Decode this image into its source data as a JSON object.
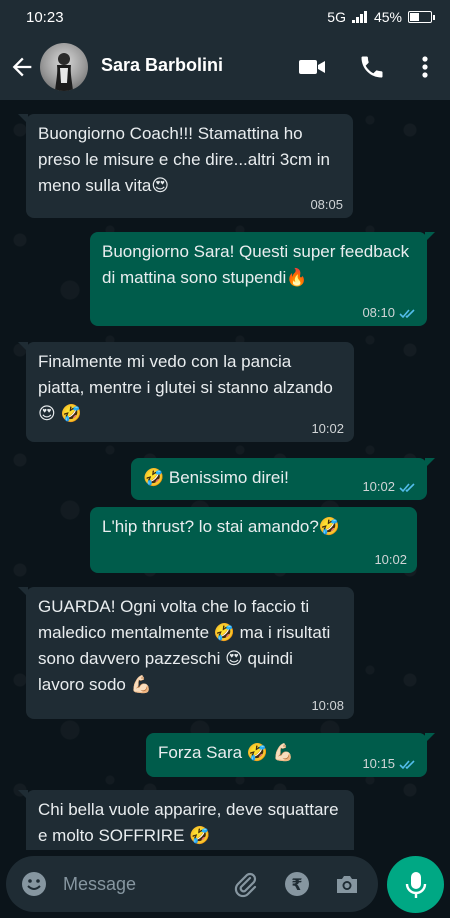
{
  "status_bar": {
    "time": "10:23",
    "network": "5G",
    "battery": "45%",
    "battery_level": 0.45
  },
  "header": {
    "contact_name": "Sara Barbolini"
  },
  "messages": [
    {
      "direction": "in",
      "text": "Buongiorno Coach!!! Stamattina ho preso le misure e che dire...altri 3cm in meno sulla vita😍",
      "time": "08:05"
    },
    {
      "direction": "out",
      "text": "Buongiorno Sara! Questi super feedback di mattina sono stupendi🔥",
      "time": "08:10",
      "status": "read"
    },
    {
      "direction": "in",
      "text": "Finalmente mi vedo con la pancia piatta, mentre i glutei si stanno alzando 😍 🤣",
      "time": "10:02"
    },
    {
      "direction": "out",
      "text": "🤣 Benissimo direi!",
      "time": "10:02",
      "status": "read"
    },
    {
      "direction": "out",
      "text": "L'hip thrust? lo stai amando?🤣",
      "time": "10:02"
    },
    {
      "direction": "in",
      "text": "GUARDA! Ogni volta che lo faccio ti maledico mentalmente 🤣 ma i risultati sono davvero pazzeschi 😍 quindi lavoro sodo 💪🏻",
      "time": "10:08"
    },
    {
      "direction": "out",
      "text": "Forza Sara 🤣 💪🏻",
      "time": "10:15",
      "status": "read"
    },
    {
      "direction": "in",
      "text": "Chi bella vuole apparire, deve squattare e molto SOFFRIRE 🤣",
      "time": ""
    }
  ],
  "input": {
    "placeholder": "Message"
  },
  "colors": {
    "incoming": "#1f2c34",
    "outgoing": "#005c4b",
    "accent": "#00a884",
    "read_ticks": "#53bdeb"
  }
}
